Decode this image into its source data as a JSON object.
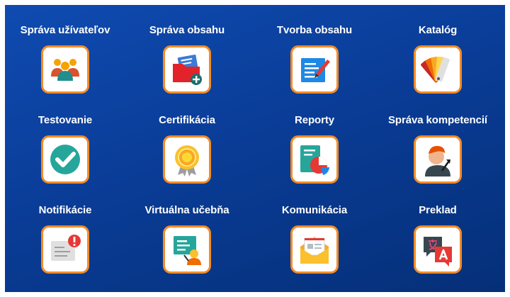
{
  "tiles": [
    {
      "label": "Správa užívateľov",
      "icon": "users-group-icon"
    },
    {
      "label": "Správa obsahu",
      "icon": "folder-add-icon"
    },
    {
      "label": "Tvorba obsahu",
      "icon": "document-edit-icon"
    },
    {
      "label": "Katalóg",
      "icon": "color-swatches-icon"
    },
    {
      "label": "Testovanie",
      "icon": "checkmark-icon"
    },
    {
      "label": "Certifikácia",
      "icon": "certificate-badge-icon"
    },
    {
      "label": "Reporty",
      "icon": "report-pie-chart-icon"
    },
    {
      "label": "Správa kompetencií",
      "icon": "person-growth-icon"
    },
    {
      "label": "Notifikácie",
      "icon": "notification-envelope-icon"
    },
    {
      "label": "Virtuálna učebňa",
      "icon": "virtual-classroom-icon"
    },
    {
      "label": "Komunikácia",
      "icon": "mail-letter-icon"
    },
    {
      "label": "Preklad",
      "icon": "translate-icon"
    }
  ],
  "colors": {
    "background": "#0a3d98",
    "tile_border": "#f28c28",
    "label_text": "#ffffff"
  }
}
